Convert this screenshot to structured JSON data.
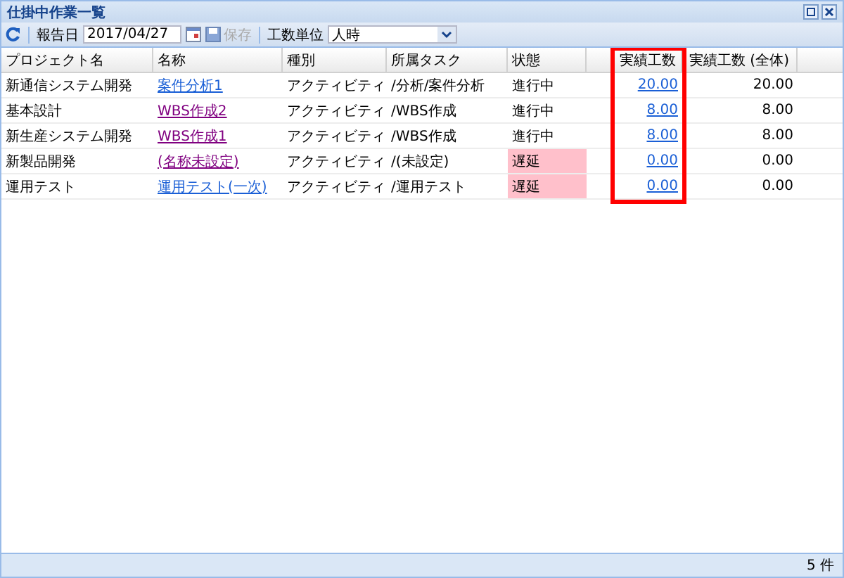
{
  "window": {
    "title": "仕掛中作業一覧"
  },
  "toolbar": {
    "date_label": "報告日",
    "date_value": "2017/04/27",
    "save": {
      "label": "保存",
      "disabled": true
    },
    "unit_label": "工数単位",
    "unit_value": "人時"
  },
  "table": {
    "columns": [
      {
        "label": "プロジェクト名"
      },
      {
        "label": "名称"
      },
      {
        "label": "種別"
      },
      {
        "label": "所属タスク"
      },
      {
        "label": "状態"
      },
      {},
      {
        "label": "実績工数",
        "highlight": true
      },
      {
        "label": "実績工数 (全体)"
      }
    ],
    "rows": [
      {
        "project": "新通信システム開発",
        "name": "案件分析1",
        "visited": false,
        "type": "アクティビティ",
        "task": "/分析/案件分析",
        "status": "進行中",
        "late": false,
        "actual": "20.00",
        "total": "20.00"
      },
      {
        "project": "基本設計",
        "name": "WBS作成2",
        "visited": true,
        "type": "アクティビティ",
        "task": "/WBS作成",
        "status": "進行中",
        "late": false,
        "actual": "8.00",
        "total": "8.00"
      },
      {
        "project": "新生産システム開発",
        "name": "WBS作成1",
        "visited": true,
        "type": "アクティビティ",
        "task": "/WBS作成",
        "status": "進行中",
        "late": false,
        "actual": "8.00",
        "total": "8.00"
      },
      {
        "project": "新製品開発",
        "name": "(名称未設定)",
        "visited": true,
        "type": "アクティビティ",
        "task": "/(未設定)",
        "status": "遅延",
        "late": true,
        "actual": "0.00",
        "total": "0.00"
      },
      {
        "project": "運用テスト",
        "name": "運用テスト(一次)",
        "visited": false,
        "type": "アクティビティ",
        "task": "/運用テスト",
        "status": "遅延",
        "late": true,
        "actual": "0.00",
        "total": "0.00"
      }
    ]
  },
  "status_bar": {
    "count": "5 件"
  }
}
